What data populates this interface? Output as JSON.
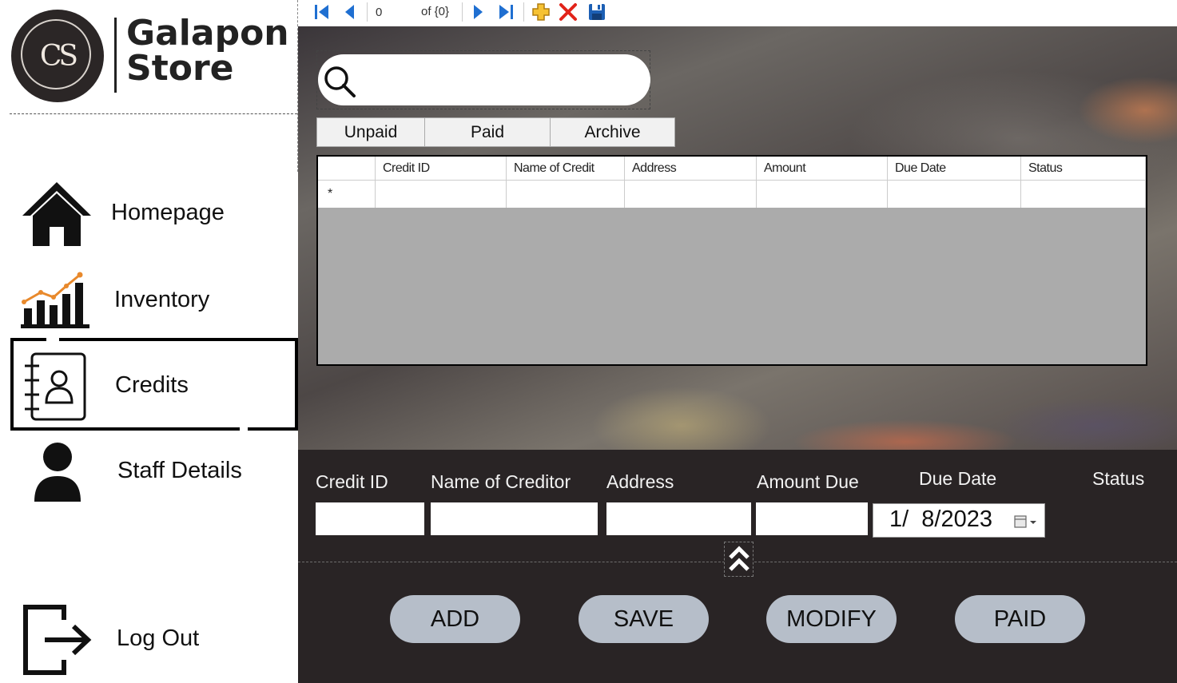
{
  "brand": {
    "line1": "Galapon",
    "line2": "Store",
    "monogram": "CS"
  },
  "nav": {
    "items": [
      {
        "label": "Homepage",
        "icon": "home-icon"
      },
      {
        "label": "Inventory",
        "icon": "bar-chart-icon"
      },
      {
        "label": "Credits",
        "icon": "contact-book-icon",
        "selected": true
      },
      {
        "label": "Staff Details",
        "icon": "person-icon"
      },
      {
        "label": "Log Out",
        "icon": "logout-icon"
      }
    ]
  },
  "toolbar": {
    "position": "0",
    "count": "of {0}",
    "icons": [
      "move-first-icon",
      "move-previous-icon",
      "move-next-icon",
      "move-last-icon",
      "add-new-icon",
      "delete-icon",
      "save-icon"
    ]
  },
  "search": {
    "icon": "search-icon",
    "value": ""
  },
  "tabs": [
    "Unpaid",
    "Paid",
    "Archive"
  ],
  "grid": {
    "columns": [
      "",
      "Credit ID",
      "Name of Credit",
      "Address",
      "Amount",
      "Due Date",
      "Status"
    ],
    "new_row_marker": "*"
  },
  "form": {
    "labels": {
      "credit_id": "Credit ID",
      "name": "Name of Creditor",
      "address": "Address",
      "amount": "Amount Due",
      "due_date": "Due Date",
      "status": "Status"
    },
    "values": {
      "credit_id": "",
      "name": "",
      "address": "",
      "amount": ""
    },
    "due_date_value": "1/  8/2023"
  },
  "actions": {
    "add": "ADD",
    "save": "SAVE",
    "modify": "MODIFY",
    "paid": "PAID"
  },
  "colors": {
    "sidebar_bg": "#ffffff",
    "panel_bg": "#292425",
    "button_bg": "#b6bec9",
    "grid_bg": "#ababab",
    "toolbar_blue": "#1f6fd1"
  }
}
